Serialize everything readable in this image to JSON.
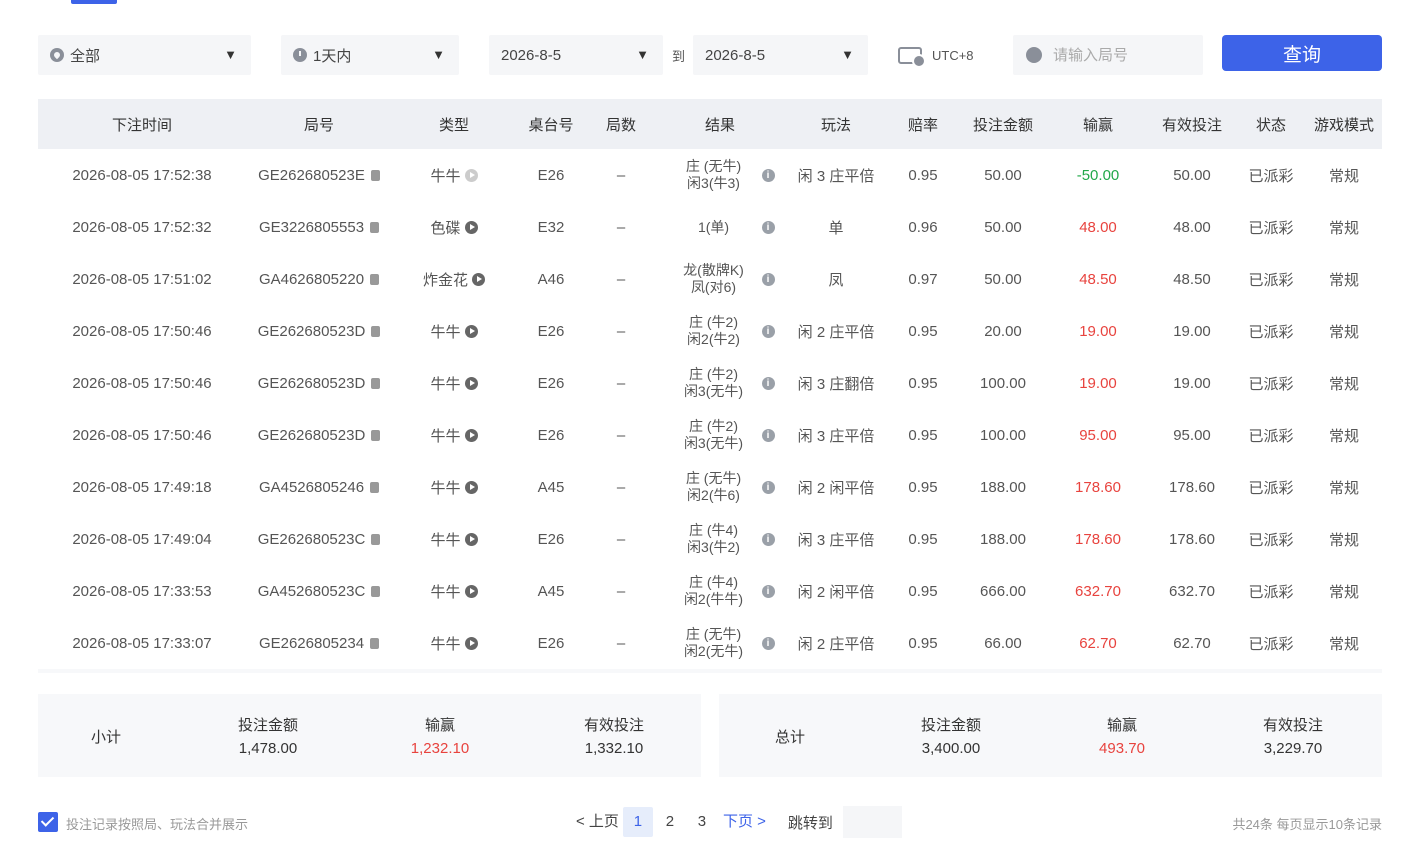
{
  "filters": {
    "category": "全部",
    "range": "1天内",
    "date_from": "2026-8-5",
    "to_label": "到",
    "date_to": "2026-8-5",
    "timezone": "UTC+8",
    "round_placeholder": "请输入局号",
    "query_label": "查询"
  },
  "table": {
    "headers": [
      "下注时间",
      "局号",
      "类型",
      "桌台号",
      "局数",
      "结果",
      "玩法",
      "赔率",
      "投注金额",
      "输赢",
      "有效投注",
      "状态",
      "游戏模式"
    ],
    "rows": [
      {
        "time": "2026-08-05 17:52:38",
        "round": "GE262680523E",
        "type": "牛牛",
        "play_dim": true,
        "table": "E26",
        "count": "–",
        "result1": "庄 (无牛)",
        "result2": "闲3(牛3)",
        "play": "闲 3 庄平倍",
        "odds": "0.95",
        "amount": "50.00",
        "winloss": "-50.00",
        "wl_sign": "neg",
        "valid": "50.00",
        "status": "已派彩",
        "mode": "常规"
      },
      {
        "time": "2026-08-05 17:52:32",
        "round": "GE3226805553",
        "type": "色碟",
        "play_dim": false,
        "table": "E32",
        "count": "–",
        "result1": "1(单)",
        "result2": "",
        "play": "单",
        "odds": "0.96",
        "amount": "50.00",
        "winloss": "48.00",
        "wl_sign": "pos",
        "valid": "48.00",
        "status": "已派彩",
        "mode": "常规"
      },
      {
        "time": "2026-08-05 17:51:02",
        "round": "GA4626805220",
        "type": "炸金花",
        "play_dim": false,
        "table": "A46",
        "count": "–",
        "result1": "龙(散牌K)",
        "result2": "凤(对6)",
        "play": "凤",
        "odds": "0.97",
        "amount": "50.00",
        "winloss": "48.50",
        "wl_sign": "pos",
        "valid": "48.50",
        "status": "已派彩",
        "mode": "常规"
      },
      {
        "time": "2026-08-05 17:50:46",
        "round": "GE262680523D",
        "type": "牛牛",
        "play_dim": false,
        "table": "E26",
        "count": "–",
        "result1": "庄 (牛2)",
        "result2": "闲2(牛2)",
        "play": "闲 2 庄平倍",
        "odds": "0.95",
        "amount": "20.00",
        "winloss": "19.00",
        "wl_sign": "pos",
        "valid": "19.00",
        "status": "已派彩",
        "mode": "常规"
      },
      {
        "time": "2026-08-05 17:50:46",
        "round": "GE262680523D",
        "type": "牛牛",
        "play_dim": false,
        "table": "E26",
        "count": "–",
        "result1": "庄 (牛2)",
        "result2": "闲3(无牛)",
        "play": "闲 3 庄翻倍",
        "odds": "0.95",
        "amount": "100.00",
        "winloss": "19.00",
        "wl_sign": "pos",
        "valid": "19.00",
        "status": "已派彩",
        "mode": "常规"
      },
      {
        "time": "2026-08-05 17:50:46",
        "round": "GE262680523D",
        "type": "牛牛",
        "play_dim": false,
        "table": "E26",
        "count": "–",
        "result1": "庄 (牛2)",
        "result2": "闲3(无牛)",
        "play": "闲 3 庄平倍",
        "odds": "0.95",
        "amount": "100.00",
        "winloss": "95.00",
        "wl_sign": "pos",
        "valid": "95.00",
        "status": "已派彩",
        "mode": "常规"
      },
      {
        "time": "2026-08-05 17:49:18",
        "round": "GA4526805246",
        "type": "牛牛",
        "play_dim": false,
        "table": "A45",
        "count": "–",
        "result1": "庄 (无牛)",
        "result2": "闲2(牛6)",
        "play": "闲 2 闲平倍",
        "odds": "0.95",
        "amount": "188.00",
        "winloss": "178.60",
        "wl_sign": "pos",
        "valid": "178.60",
        "status": "已派彩",
        "mode": "常规"
      },
      {
        "time": "2026-08-05 17:49:04",
        "round": "GE262680523C",
        "type": "牛牛",
        "play_dim": false,
        "table": "E26",
        "count": "–",
        "result1": "庄 (牛4)",
        "result2": "闲3(牛2)",
        "play": "闲 3 庄平倍",
        "odds": "0.95",
        "amount": "188.00",
        "winloss": "178.60",
        "wl_sign": "pos",
        "valid": "178.60",
        "status": "已派彩",
        "mode": "常规"
      },
      {
        "time": "2026-08-05 17:33:53",
        "round": "GA452680523C",
        "type": "牛牛",
        "play_dim": false,
        "table": "A45",
        "count": "–",
        "result1": "庄 (牛4)",
        "result2": "闲2(牛牛)",
        "play": "闲 2 闲平倍",
        "odds": "0.95",
        "amount": "666.00",
        "winloss": "632.70",
        "wl_sign": "pos",
        "valid": "632.70",
        "status": "已派彩",
        "mode": "常规"
      },
      {
        "time": "2026-08-05 17:33:07",
        "round": "GE2626805234",
        "type": "牛牛",
        "play_dim": false,
        "table": "E26",
        "count": "–",
        "result1": "庄 (无牛)",
        "result2": "闲2(无牛)",
        "play": "闲 2 庄平倍",
        "odds": "0.95",
        "amount": "66.00",
        "winloss": "62.70",
        "wl_sign": "pos",
        "valid": "62.70",
        "status": "已派彩",
        "mode": "常规"
      }
    ]
  },
  "subtotal": {
    "title": "小计",
    "amount_label": "投注金额",
    "amount": "1,478.00",
    "winloss_label": "输赢",
    "winloss": "1,232.10",
    "valid_label": "有效投注",
    "valid": "1,332.10"
  },
  "total": {
    "title": "总计",
    "amount_label": "投注金额",
    "amount": "3,400.00",
    "winloss_label": "输赢",
    "winloss": "493.70",
    "valid_label": "有效投注",
    "valid": "3,229.70"
  },
  "footer": {
    "merge_label": "投注记录按照局、玩法合并展示",
    "prev": "< 上页",
    "pages": [
      "1",
      "2",
      "3"
    ],
    "next": "下页 >",
    "jump_label": "跳转到",
    "count_info": "共24条  每页显示10条记录"
  },
  "colors": {
    "accent": "#3d63e8",
    "win": "#e8433e",
    "loss": "#22a84a"
  }
}
